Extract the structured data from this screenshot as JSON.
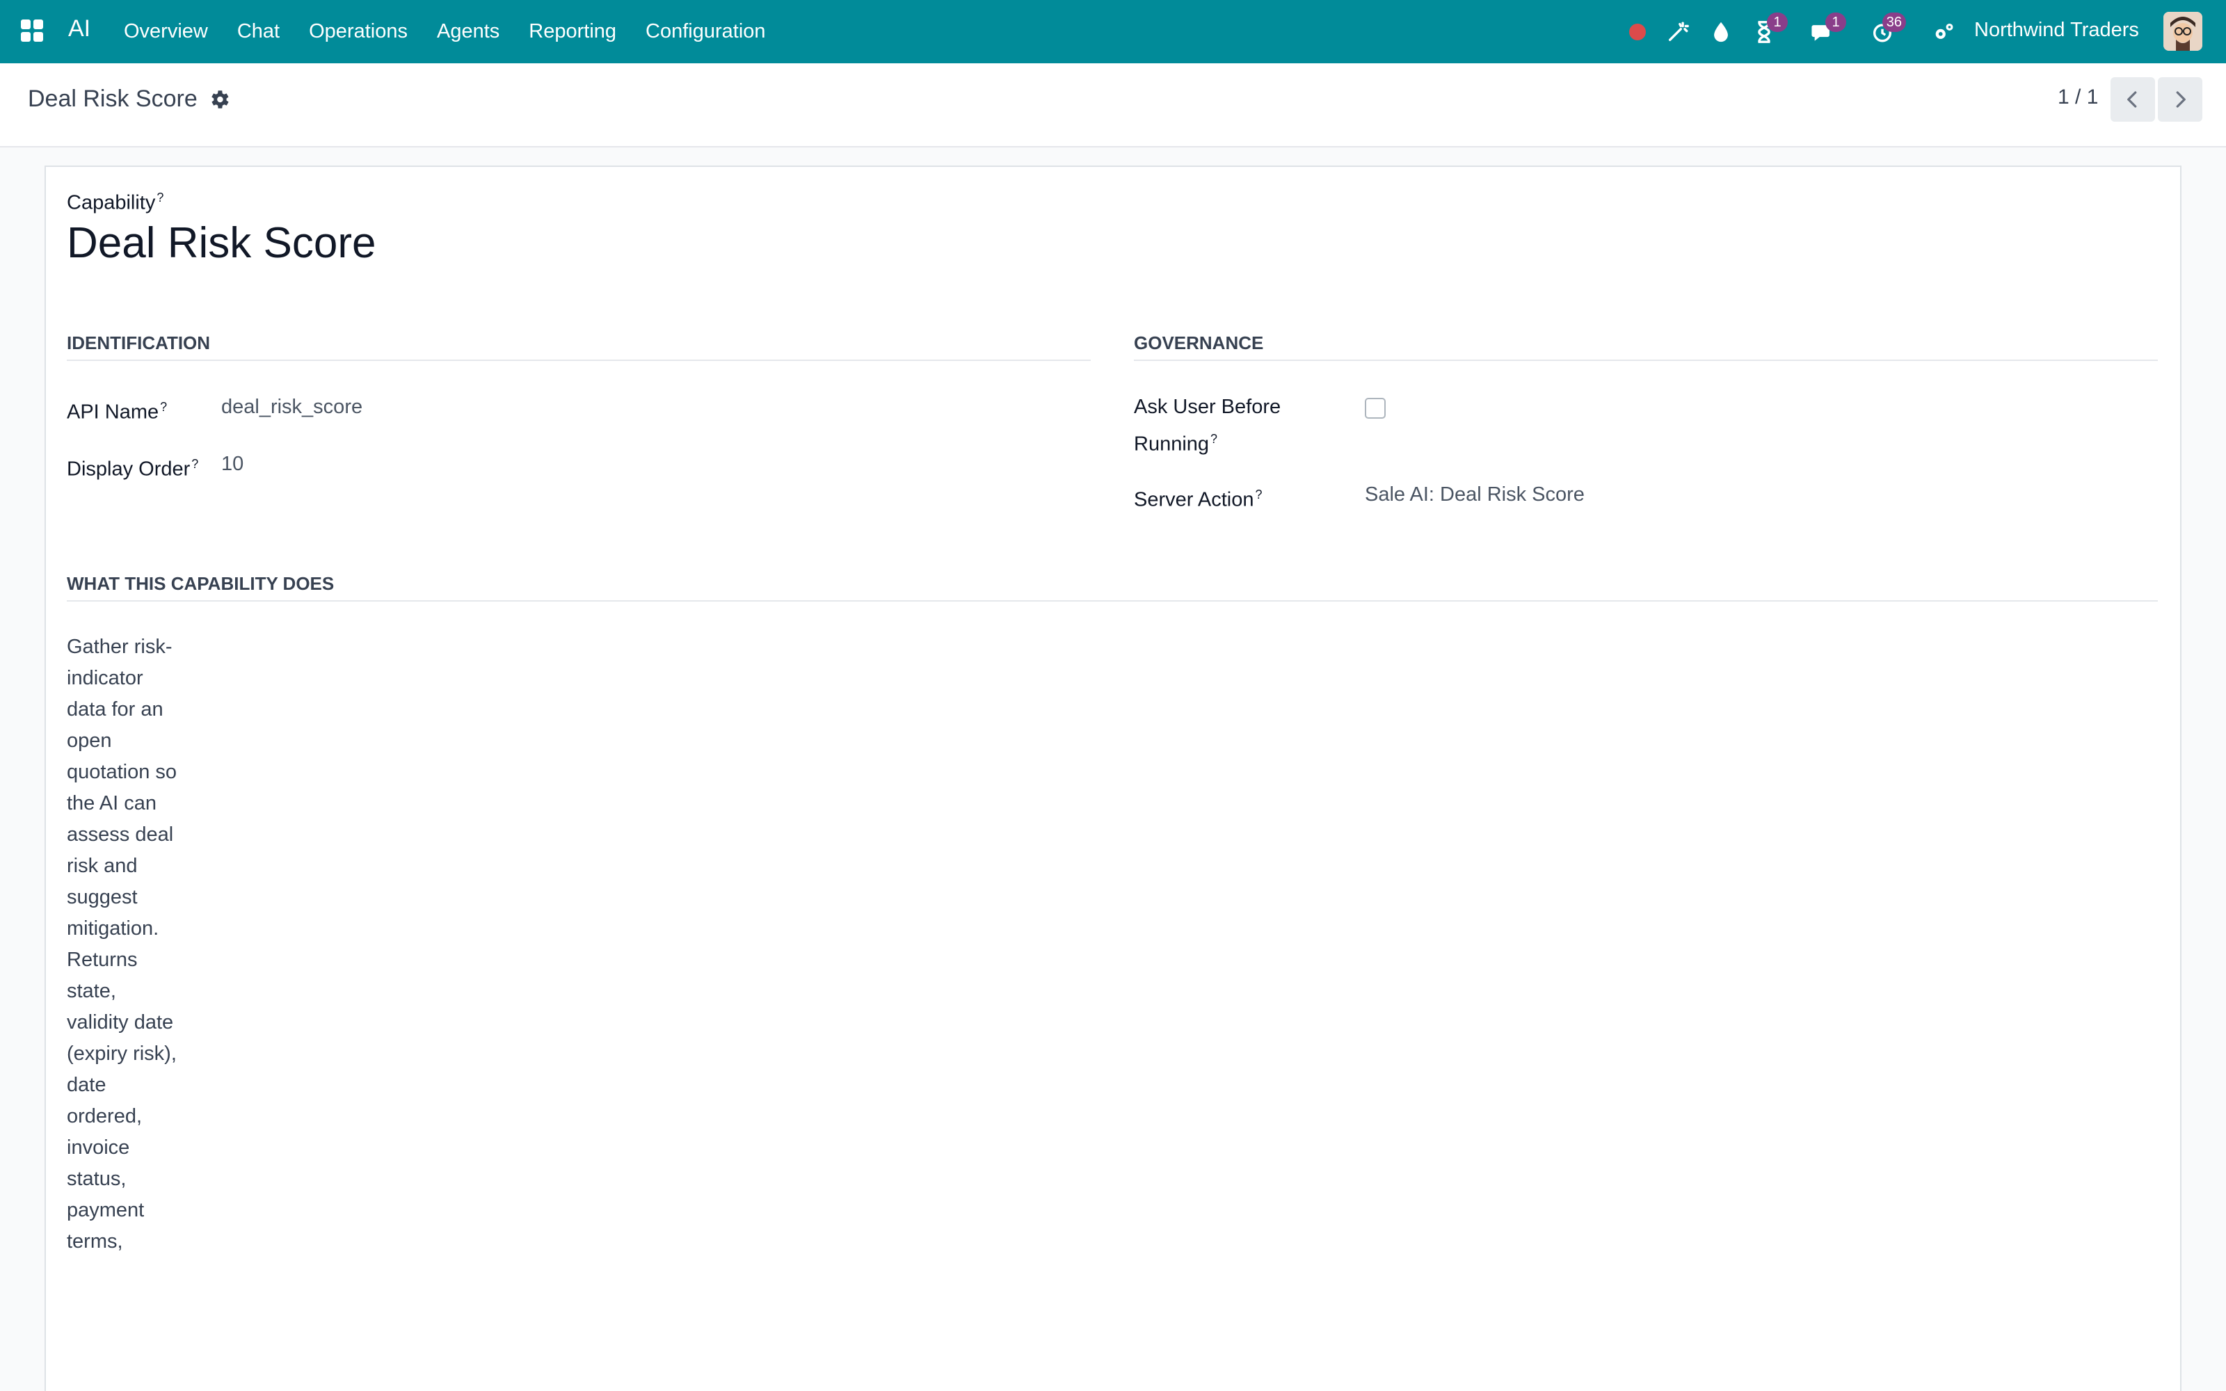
{
  "navbar": {
    "app_name": "AI",
    "menu": [
      "Overview",
      "Chat",
      "Operations",
      "Agents",
      "Reporting",
      "Configuration"
    ],
    "badges": {
      "activity": "1",
      "messages": "1",
      "timer": "36"
    },
    "company": "Northwind Traders"
  },
  "control_panel": {
    "title": "Deal Risk Score",
    "pager": "1 / 1"
  },
  "form": {
    "capability_label": "Capability",
    "help_mark": "?",
    "name": "Deal Risk Score",
    "identification": {
      "title": "Identification",
      "api_name_label": "API Name",
      "api_name": "deal_risk_score",
      "display_order_label": "Display Order",
      "display_order": "10"
    },
    "governance": {
      "title": "Governance",
      "ask_user_label": "Ask User Before Running",
      "ask_user": false,
      "server_action_label": "Server Action",
      "server_action": "Sale AI: Deal Risk Score"
    },
    "description": {
      "title": "What This Capability Does",
      "text": "Gather risk-indicator data for an open quotation so the AI can assess deal risk and suggest mitigation. Returns state, validity date (expiry risk), date ordered, invoice status, payment terms,"
    }
  },
  "colors": {
    "navbar": "#018b99",
    "badge": "#8a3e8a",
    "record": "#dc4b4b"
  }
}
